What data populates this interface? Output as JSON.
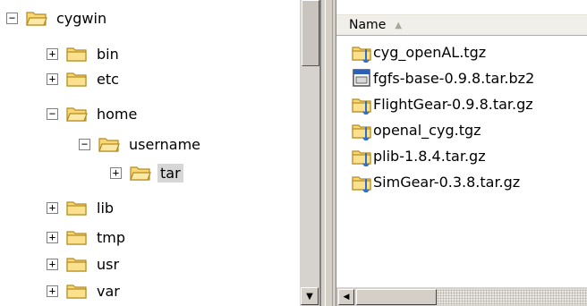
{
  "tree": {
    "nodes": [
      {
        "label": "cygwin",
        "expander": "−",
        "open": true
      },
      {
        "label": "bin",
        "expander": "+",
        "open": false
      },
      {
        "label": "etc",
        "expander": "+",
        "open": false
      },
      {
        "label": "home",
        "expander": "−",
        "open": true
      },
      {
        "label": "username",
        "expander": "−",
        "open": true
      },
      {
        "label": "tar",
        "expander": "+",
        "open": true,
        "selected": true
      },
      {
        "label": "lib",
        "expander": "+",
        "open": false
      },
      {
        "label": "tmp",
        "expander": "+",
        "open": false
      },
      {
        "label": "usr",
        "expander": "+",
        "open": false
      },
      {
        "label": "var",
        "expander": "+",
        "open": false
      }
    ]
  },
  "file_list": {
    "column_header": "Name",
    "sort_indicator": "▲",
    "files": [
      {
        "name": "cyg_openAL.tgz",
        "icon": "archive-icon"
      },
      {
        "name": "fgfs-base-0.9.8.tar.bz2",
        "icon": "file-icon"
      },
      {
        "name": "FlightGear-0.9.8.tar.gz",
        "icon": "archive-icon"
      },
      {
        "name": "openal_cyg.tgz",
        "icon": "archive-icon"
      },
      {
        "name": "plib-1.8.4.tar.gz",
        "icon": "archive-icon"
      },
      {
        "name": "SimGear-0.3.8.tar.gz",
        "icon": "archive-icon"
      }
    ]
  },
  "scrollbars": {
    "down_arrow": "▼",
    "left_arrow": "◀"
  },
  "colors": {
    "folder_fill": "#f8d775",
    "folder_edge": "#b58b1f",
    "selection": "#d6d6d6",
    "header_bg": "#f0efe9"
  }
}
